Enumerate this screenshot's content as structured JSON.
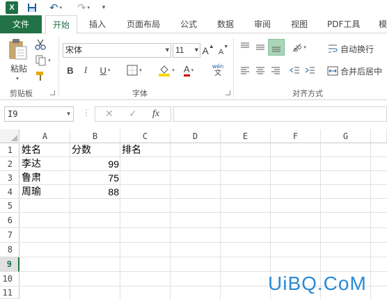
{
  "qat": {
    "undo_glyph": "↶",
    "redo_glyph": "↷",
    "more_glyph": "▾"
  },
  "tabs": [
    "文件",
    "开始",
    "插入",
    "页面布局",
    "公式",
    "数据",
    "审阅",
    "视图",
    "PDF工具",
    "模"
  ],
  "ribbon": {
    "clipboard": {
      "paste_label": "粘贴",
      "group_label": "剪贴板"
    },
    "font": {
      "font_name": "宋体",
      "font_size": "11",
      "bold": "B",
      "italic": "I",
      "underline": "U",
      "grow": "A",
      "shrink": "A",
      "font_color": "A",
      "wen": "wén",
      "wen_sub": "文",
      "group_label": "字体"
    },
    "alignment": {
      "wrap_text": "自动换行",
      "merge_center": "合并后居中",
      "group_label": "对齐方式"
    },
    "colors": {
      "accent": "#217346",
      "highlight_yellow": "#ffd600",
      "font_red": "#d00000"
    }
  },
  "formula_bar": {
    "name_box": "I9",
    "fx": "fx",
    "cancel": "✕",
    "enter": "✓",
    "separator": "⋮"
  },
  "grid": {
    "columns": [
      "A",
      "B",
      "C",
      "D",
      "E",
      "F",
      "G"
    ],
    "rows": [
      "1",
      "2",
      "3",
      "4",
      "5",
      "6",
      "7",
      "8",
      "9",
      "10",
      "11"
    ],
    "active_row": "9",
    "cells": {
      "A1": "姓名",
      "B1": "分数",
      "C1": "排名",
      "A2": "李达",
      "B2": "99",
      "A3": "鲁肃",
      "B3": "75",
      "A4": "周瑜",
      "B4": "88"
    }
  },
  "watermark": "UiBQ.CoM"
}
